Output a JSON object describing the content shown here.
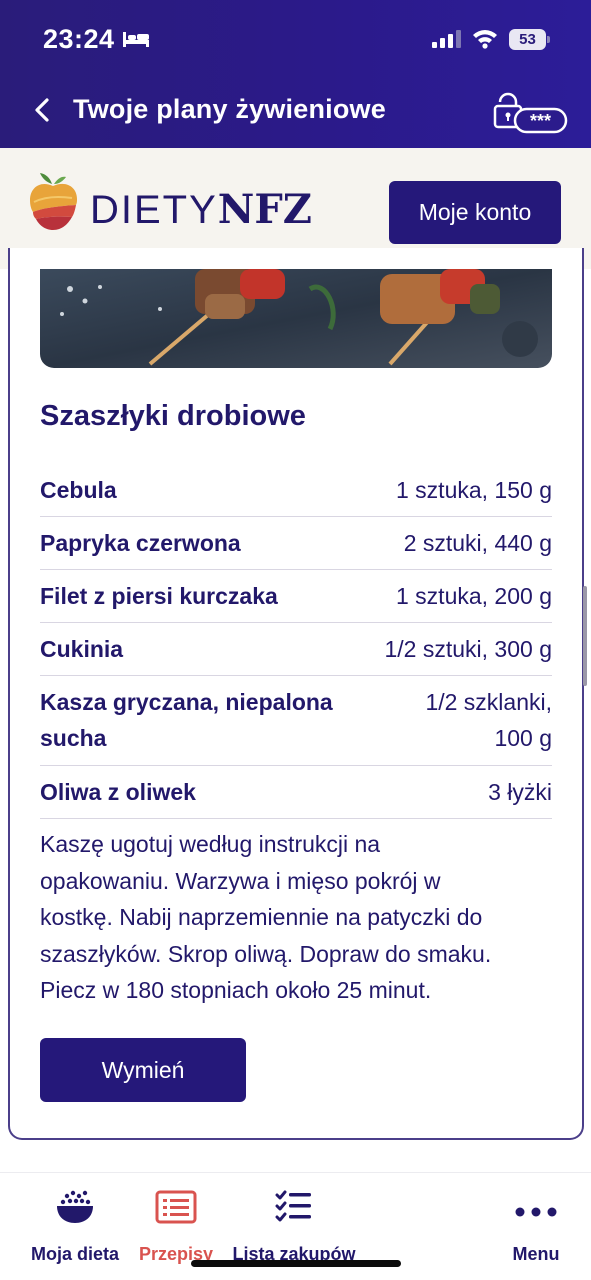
{
  "status_bar": {
    "time": "23:24",
    "battery": "53",
    "icons": [
      "bed-icon",
      "signal-icon",
      "wifi-icon",
      "battery-icon"
    ]
  },
  "nav": {
    "title": "Twoje plany żywieniowe",
    "back_icon": "chevron-left-icon",
    "lock_badge": "***"
  },
  "brand": {
    "wordmark_thin": "DIETY",
    "wordmark_bold": "NFZ",
    "account_button": "Moje konto"
  },
  "recipe": {
    "title": "Szaszłyki drobiowe",
    "ingredients": [
      {
        "name": "Cebula",
        "qty": "1 sztuka, 150 g"
      },
      {
        "name": "Papryka czerwona",
        "qty": "2 sztuki, 440 g"
      },
      {
        "name": "Filet z piersi kurczaka",
        "qty": "1 sztuka, 200 g"
      },
      {
        "name": "Cukinia",
        "qty": "1/2 sztuki, 300 g"
      },
      {
        "name": "Kasza gryczana, niepalona",
        "name2": "sucha",
        "qty": "1/2 szklanki,",
        "qty2": "100 g"
      },
      {
        "name": "Oliwa z oliwek",
        "qty": "3 łyżki"
      }
    ],
    "instructions": [
      "Kaszę ugotuj według instrukcji na",
      "opakowaniu. Warzywa i mięso pokrój w",
      "kostkę. Nabij naprzemiennie na patyczki do",
      "szaszłyków. Skrop oliwą. Dopraw do smaku.",
      "Piecz w 180 stopniach około 25 minut."
    ],
    "swap_button": "Wymień"
  },
  "tabbar": {
    "tabs": [
      {
        "label": "Moja dieta",
        "icon": "rice-bowl-icon",
        "active": false
      },
      {
        "label": "Przepisy",
        "icon": "recipe-list-icon",
        "active": true
      },
      {
        "label": "Lista zakupów",
        "icon": "checklist-icon",
        "active": false
      },
      {
        "label": "Menu",
        "icon": "more-dots-icon",
        "active": false
      }
    ]
  },
  "colors": {
    "primary": "#25187a",
    "header_gradient_start": "#2a1c7a",
    "header_gradient_end": "#2c1d98",
    "active_tab": "#d9534f",
    "brand_bg": "#f6f4ef"
  }
}
